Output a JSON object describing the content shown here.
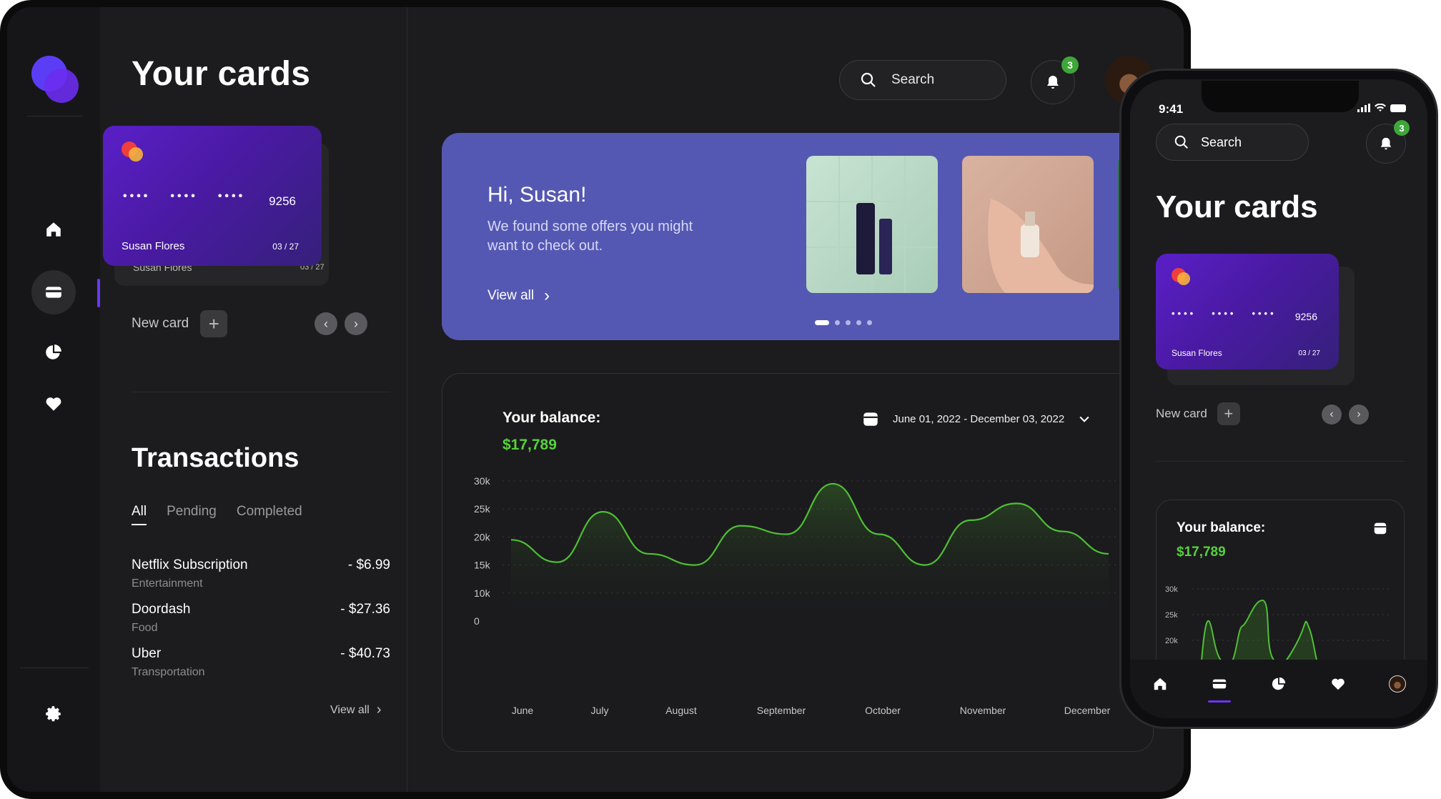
{
  "sidebar": {
    "items": [
      {
        "icon": "home-icon"
      },
      {
        "icon": "card-icon",
        "active": true
      },
      {
        "icon": "pie-chart-icon"
      },
      {
        "icon": "heart-icon"
      }
    ],
    "footer_icon": "gear-icon"
  },
  "cards": {
    "title": "Your cards",
    "card": {
      "dots": [
        "••••",
        "••••",
        "••••"
      ],
      "last4": "9256",
      "holder": "Susan Flores",
      "expiry": "03 / 27"
    },
    "behind_card": {
      "holder": "Susan Flores",
      "expiry": "03 / 27"
    },
    "new_card_label": "New card"
  },
  "transactions": {
    "title": "Transactions",
    "tabs": [
      "All",
      "Pending",
      "Completed"
    ],
    "active_tab": "All",
    "items": [
      {
        "name": "Netflix Subscription",
        "category": "Entertainment",
        "amount": "- $6.99"
      },
      {
        "name": "Doordash",
        "category": "Food",
        "amount": "- $27.36"
      },
      {
        "name": "Uber",
        "category": "Transportation",
        "amount": "- $40.73"
      }
    ],
    "view_all": "View all"
  },
  "header": {
    "search_placeholder": "Search",
    "notifications_count": "3"
  },
  "banner": {
    "greeting": "Hi, Susan!",
    "message": "We found some offers you might want to check out.",
    "view_all": "View all",
    "pages": 5,
    "active_page": 1
  },
  "balance": {
    "title": "Your balance:",
    "value": "$17,789",
    "date_range": "June 01, 2022 - December 03, 2022"
  },
  "phone": {
    "time": "9:41",
    "search_placeholder": "Search",
    "notifications_count": "3",
    "title": "Your cards",
    "card": {
      "dots": [
        "••••",
        "••••",
        "••••"
      ],
      "last4": "9256",
      "holder": "Susan Flores",
      "expiry": "03 / 27"
    },
    "new_card_label": "New card",
    "balance_title": "Your balance:",
    "balance_value": "$17,789",
    "tabs": [
      "home-icon",
      "card-icon",
      "pie-chart-icon",
      "heart-icon",
      "avatar"
    ],
    "chart_ticks": [
      "30k",
      "25k",
      "20k"
    ]
  },
  "colors": {
    "accent": "#6a35f4",
    "positive": "#55d23c",
    "banner": "#5558b2",
    "badge": "#3fa63a"
  },
  "chart_data": {
    "type": "area",
    "title": "",
    "xlabel": "",
    "ylabel": "",
    "categories": [
      "June",
      "July",
      "August",
      "September",
      "October",
      "November",
      "December"
    ],
    "yticks": [
      "0",
      "10k",
      "15k",
      "20k",
      "25k",
      "30k"
    ],
    "ylim": [
      0,
      30000
    ],
    "grid": true,
    "series": [
      {
        "values": [
          19500,
          15500,
          24500,
          17000,
          15000,
          22000,
          20500,
          29500,
          20500,
          15000,
          23000,
          26000,
          21000,
          17000
        ]
      }
    ]
  }
}
